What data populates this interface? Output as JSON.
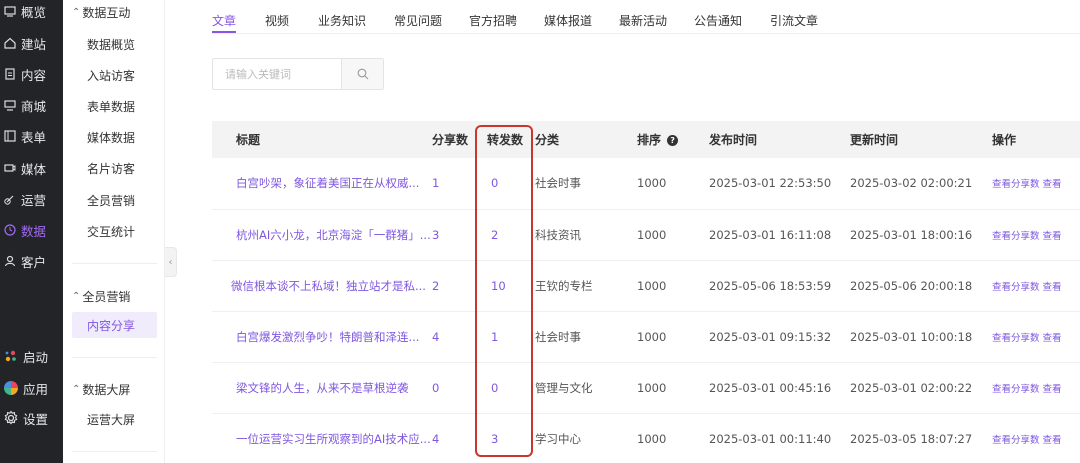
{
  "rail": [
    {
      "label": "概览",
      "icon": "overview-icon"
    },
    {
      "label": "建站",
      "icon": "home-icon"
    },
    {
      "label": "内容",
      "icon": "document-icon"
    },
    {
      "label": "商城",
      "icon": "shop-icon"
    },
    {
      "label": "表单",
      "icon": "form-icon"
    },
    {
      "label": "媒体",
      "icon": "media-icon"
    },
    {
      "label": "运营",
      "icon": "link-icon"
    },
    {
      "label": "数据",
      "icon": "clock-icon",
      "active": true
    },
    {
      "label": "客户",
      "icon": "user-icon"
    },
    {
      "label": "启动",
      "icon": "launch-icon"
    },
    {
      "label": "应用",
      "icon": "app-icon"
    },
    {
      "label": "设置",
      "icon": "gear-icon"
    }
  ],
  "subnav": {
    "group1": "数据互动",
    "group1_items": [
      "数据概览",
      "入站访客",
      "表单数据",
      "媒体数据",
      "名片访客",
      "全员营销",
      "交互统计"
    ],
    "group2": "全员营销",
    "group2_items": [
      "内容分享"
    ],
    "group3": "数据大屏",
    "group3_items": [
      "运营大屏"
    ]
  },
  "tabs": [
    "文章",
    "视频",
    "业务知识",
    "常见问题",
    "官方招聘",
    "媒体报道",
    "最新活动",
    "公告通知",
    "引流文章"
  ],
  "search": {
    "placeholder": "请输入关键词"
  },
  "table": {
    "headers": [
      "标题",
      "分享数",
      "转发数",
      "分类",
      "排序",
      "发布时间",
      "更新时间",
      "操作"
    ],
    "rows": [
      {
        "title": "白宫吵架，象征着美国正在从权威...",
        "share": "1",
        "forward": "0",
        "category": "社会时事",
        "order": "1000",
        "published": "2025-03-01 22:53:50",
        "updated": "2025-03-02 02:00:21",
        "op": "查看分享数",
        "op2": "查看"
      },
      {
        "title": "杭州AI六小龙，北京海淀「一群猪」...",
        "share": "3",
        "forward": "2",
        "category": "科技资讯",
        "order": "1000",
        "published": "2025-03-01 16:11:08",
        "updated": "2025-03-01 18:00:16",
        "op": "查看分享数",
        "op2": "查看"
      },
      {
        "title": "微信根本谈不上私域！独立站才是私...",
        "share": "2",
        "forward": "10",
        "category": "王钦的专栏",
        "order": "1000",
        "published": "2025-05-06 18:53:59",
        "updated": "2025-05-06 20:00:18",
        "op": "查看分享数",
        "op2": "查看"
      },
      {
        "title": "白宫爆发激烈争吵！特朗普和泽连...",
        "share": "4",
        "forward": "1",
        "category": "社会时事",
        "order": "1000",
        "published": "2025-03-01 09:15:32",
        "updated": "2025-03-01 10:00:18",
        "op": "查看分享数",
        "op2": "查看"
      },
      {
        "title": "梁文锋的人生，从来不是草根逆袭",
        "share": "0",
        "forward": "0",
        "category": "管理与文化",
        "order": "1000",
        "published": "2025-03-01 00:45:16",
        "updated": "2025-03-01 02:00:22",
        "op": "查看分享数",
        "op2": "查看"
      },
      {
        "title": "一位运营实习生所观察到的AI技术应...",
        "share": "4",
        "forward": "3",
        "category": "学习中心",
        "order": "1000",
        "published": "2025-03-01 00:11:40",
        "updated": "2025-03-05 18:07:27",
        "op": "查看分享数",
        "op2": "查看"
      }
    ]
  },
  "colors": {
    "accent": "#8656e6",
    "highlight": "#c8362c",
    "rail_bg": "#222427"
  }
}
